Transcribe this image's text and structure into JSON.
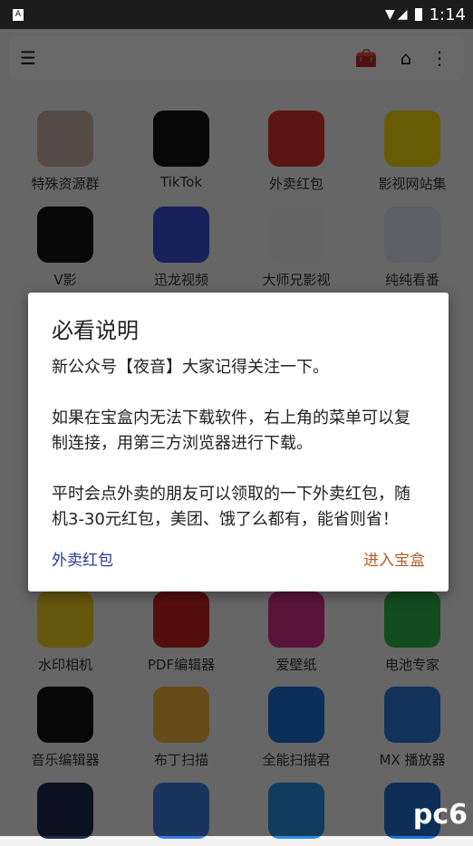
{
  "status_bar": {
    "time": "1:14",
    "notification_icon": "A"
  },
  "toolbar": {
    "icons": [
      "menu-indent-icon",
      "medkit-icon",
      "home-icon",
      "more-vert-icon"
    ]
  },
  "apps": [
    {
      "label": "特殊资源群",
      "color": "#c9b3a8"
    },
    {
      "label": "TikTok",
      "color": "#111111"
    },
    {
      "label": "外卖红包",
      "color": "#d8362e"
    },
    {
      "label": "影视网站集",
      "color": "#f5d90a"
    },
    {
      "label": "V影",
      "color": "#111111"
    },
    {
      "label": "迅龙视频",
      "color": "#3d4fd6"
    },
    {
      "label": "大师兄影视",
      "color": "#f0f0f0"
    },
    {
      "label": "纯纯看番",
      "color": "#dfe3f0"
    },
    {
      "label": "水印相机",
      "color": "#f0d020"
    },
    {
      "label": "PDF编辑器",
      "color": "#c8251f"
    },
    {
      "label": "爱壁纸",
      "color": "#d6308a"
    },
    {
      "label": "电池专家",
      "color": "#2fb54a"
    },
    {
      "label": "音乐编辑器",
      "color": "#111111"
    },
    {
      "label": "布丁扫描",
      "color": "#f2b53a"
    },
    {
      "label": "全能扫描君",
      "color": "#1c6fd6"
    },
    {
      "label": "MX 播放器",
      "color": "#2a79d6"
    },
    {
      "label": "",
      "color": "#1d2d4a"
    },
    {
      "label": "",
      "color": "#3c7fe0"
    },
    {
      "label": "",
      "color": "#2a8fe0"
    },
    {
      "label": "",
      "color": "#1f70d0"
    }
  ],
  "dialog": {
    "title": "必看说明",
    "paragraphs": [
      "新公众号【夜音】大家记得关注一下。",
      "如果在宝盒内无法下载软件，右上角的菜单可以复制连接，用第三方浏览器进行下载。",
      "平时会点外卖的朋友可以领取的一下外卖红包，随机3-30元红包，美团、饿了么都有，能省则省！"
    ],
    "left_button": "外卖红包",
    "right_button": "进入宝盒",
    "left_color": "#283a8e",
    "right_color": "#b0602a"
  },
  "watermark": "pc6"
}
